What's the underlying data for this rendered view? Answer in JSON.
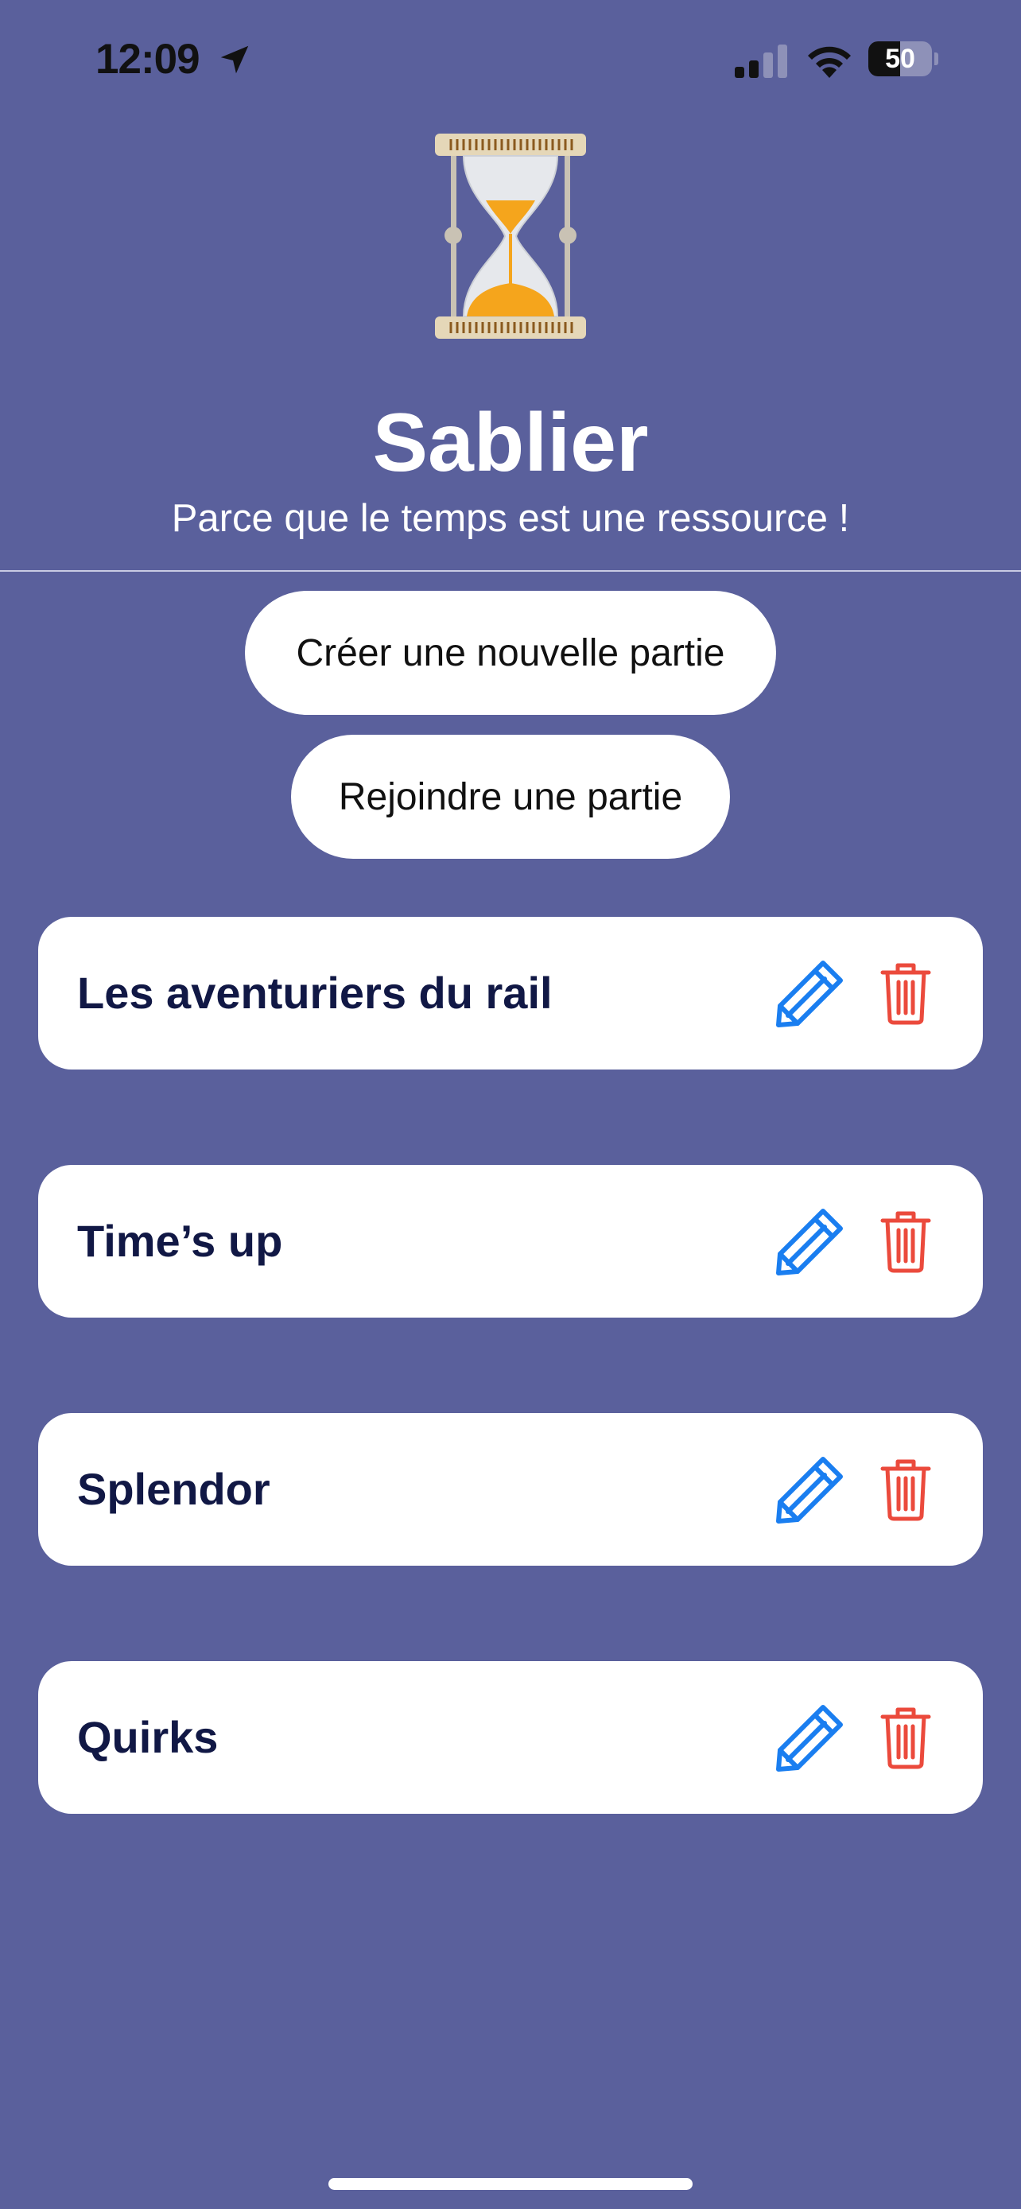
{
  "status_bar": {
    "time": "12:09",
    "battery_percent": "50",
    "battery_level": 0.5,
    "icons": [
      "location-arrow-icon",
      "cellular-signal-icon",
      "wifi-icon",
      "battery-icon"
    ]
  },
  "header": {
    "logo_icon": "hourglass-icon",
    "title": "Sablier",
    "subtitle": "Parce que le temps est une ressource !"
  },
  "actions": {
    "create_label": "Créer une nouvelle partie",
    "join_label": "Rejoindre une partie"
  },
  "games": [
    {
      "name": "Les aventuriers du rail",
      "edit_icon": "pencil-icon",
      "delete_icon": "trash-icon"
    },
    {
      "name": "Time’s up",
      "edit_icon": "pencil-icon",
      "delete_icon": "trash-icon"
    },
    {
      "name": "Splendor",
      "edit_icon": "pencil-icon",
      "delete_icon": "trash-icon"
    },
    {
      "name": "Quirks",
      "edit_icon": "pencil-icon",
      "delete_icon": "trash-icon"
    }
  ],
  "colors": {
    "background": "#5a609c",
    "card": "#ffffff",
    "game_name": "#111845",
    "edit_icon": "#1a7ef0",
    "delete_icon": "#eb4a3c",
    "sand": "#f5a51c"
  }
}
